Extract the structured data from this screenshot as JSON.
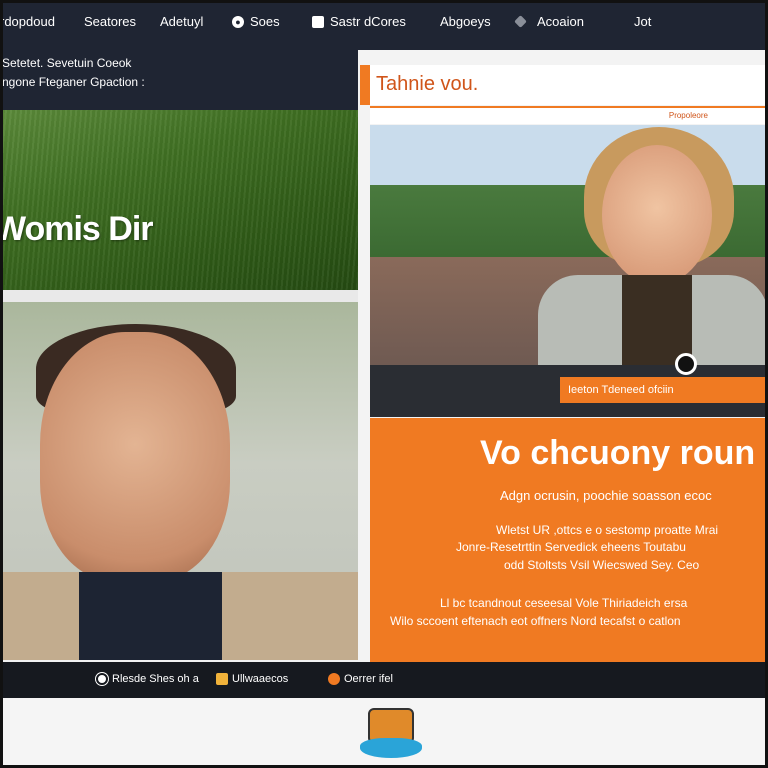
{
  "nav": {
    "items": [
      {
        "label": "rdopdoud",
        "icon": null
      },
      {
        "label": "Seatores",
        "icon": null
      },
      {
        "label": "Adetuyl",
        "icon": null
      },
      {
        "label": "Soes",
        "icon": "circle-icon"
      },
      {
        "label": "Sastr dCores",
        "icon": "square-icon"
      },
      {
        "label": "Abgoeys",
        "icon": null
      },
      {
        "label": "Acoaion",
        "icon": "tag-icon"
      },
      {
        "label": "Jot",
        "icon": null
      }
    ]
  },
  "hero": {
    "line1": "Setetet. Sevetuin Coeok",
    "line2": "ngone Fteganer Gpaction :",
    "brand_text": "Womis Dir"
  },
  "feature": {
    "title": "Tahnie vou.",
    "subtitle_small": "Propoleore",
    "caption": "Ieeton Tdeneed ofciin"
  },
  "promo": {
    "headline": "Vo chcuony roun",
    "lead": "Adgn ocrusin, poochie soasson ecoc",
    "para1_l1": "Wletst UR ,ottcs e o sestomp proatte Mrai",
    "para1_l2": "Jonre-Resetrttin Servedick eheens Toutabu",
    "para1_l3": "odd Stoltsts Vsil Wiecswed Sey. Ceo",
    "para2_l1": "Ll bc tcandnout ceseesal Vole Thiriadeich ersa",
    "para2_l2": "Wilo sccoent eftenach eot offners Nord tecafst o catlon"
  },
  "bottom_bar": {
    "item1": "Rlesde Shes oh a",
    "item2": "Ullwaaecos",
    "item3": "Oerrer ifel"
  },
  "colors": {
    "nav_bg": "#1f2533",
    "accent_orange": "#f07a22",
    "bottom_bar": "#16191f"
  }
}
